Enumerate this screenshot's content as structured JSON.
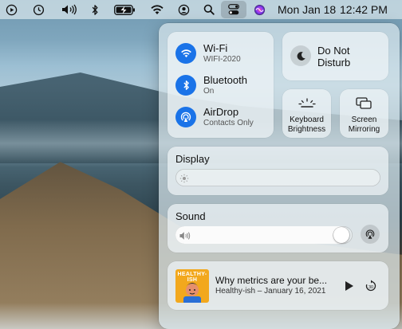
{
  "menubar": {
    "date": "Mon Jan 18",
    "time": "12:42 PM",
    "icons": [
      "play-circle-icon",
      "clock-icon",
      "volume-icon",
      "bluetooth-icon",
      "battery-charging-icon",
      "wifi-icon",
      "user-icon",
      "search-icon",
      "control-center-icon",
      "siri-icon"
    ]
  },
  "connectivity": {
    "wifi": {
      "title": "Wi-Fi",
      "subtitle": "WIFI-2020"
    },
    "bluetooth": {
      "title": "Bluetooth",
      "subtitle": "On"
    },
    "airdrop": {
      "title": "AirDrop",
      "subtitle": "Contacts Only"
    }
  },
  "dnd": {
    "line1": "Do Not",
    "line2": "Disturb"
  },
  "keyboard_brightness": {
    "line1": "Keyboard",
    "line2": "Brightness"
  },
  "screen_mirroring": {
    "line1": "Screen",
    "line2": "Mirroring"
  },
  "display": {
    "title": "Display",
    "brightness_level": 0.0
  },
  "sound": {
    "title": "Sound",
    "volume_level": 0.98
  },
  "now_playing": {
    "title": "Why metrics are your be...",
    "subtitle": "Healthy-ish – January 16, 2021",
    "artwork_text": "HEALTHY-ISH"
  },
  "colors": {
    "accent": "#1a73e8",
    "artwork_bg": "#f2a81d"
  }
}
